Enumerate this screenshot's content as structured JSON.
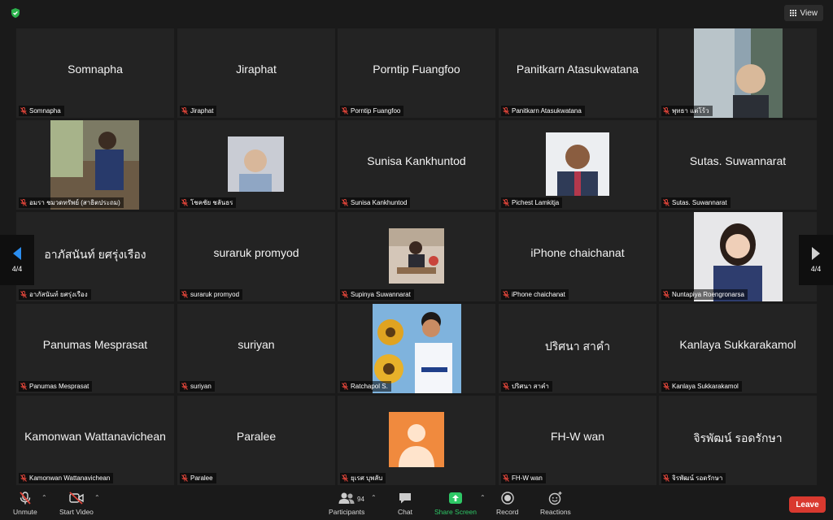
{
  "topbar": {
    "view_label": "View"
  },
  "pager": {
    "left_label": "4/4",
    "right_label": "4/4"
  },
  "tiles": [
    {
      "big": "Somnapha",
      "caption": "Somnapha"
    },
    {
      "big": "Jiraphat",
      "caption": "Jiraphat"
    },
    {
      "big": "Porntip Fuangfoo",
      "caption": "Porntip Fuangfoo"
    },
    {
      "big": "Panitkarn Atasukwatana",
      "caption": "Panitkarn Atasukwatana"
    },
    {
      "big": "",
      "caption": "พุทธา แต่โร้ว"
    },
    {
      "big": "",
      "caption": "อมรา ชมวดทรัพย์ (สาธิตประถม)"
    },
    {
      "big": "",
      "caption": "โชคชัย ชลันธร"
    },
    {
      "big": "Sunisa Kankhuntod",
      "caption": "Sunisa Kankhuntod"
    },
    {
      "big": "",
      "caption": "Pichest Lamkitja"
    },
    {
      "big": "Sutas. Suwannarat",
      "caption": "Sutas. Suwannarat"
    },
    {
      "big": "อาภัสนันท์ ยศรุ่งเรือง",
      "caption": "อาภัสนันท์ ยศรุ่งเรือง"
    },
    {
      "big": "suraruk promyod",
      "caption": "suraruk promyod"
    },
    {
      "big": "",
      "caption": "Supinya Suwannarat"
    },
    {
      "big": "iPhone chaichanat",
      "caption": "iPhone chaichanat"
    },
    {
      "big": "",
      "caption": "Nuntapiya Roengronarsa"
    },
    {
      "big": "Panumas Mesprasat",
      "caption": "Panumas Mesprasat"
    },
    {
      "big": "suriyan",
      "caption": "suriyan"
    },
    {
      "big": "",
      "caption": "Ratchapol S."
    },
    {
      "big": "ปริศนา สาคำ",
      "caption": "ปริศนา สาคำ"
    },
    {
      "big": "Kanlaya Sukkarakamol",
      "caption": "Kanlaya Sukkarakamol"
    },
    {
      "big": "Kamonwan Wattanavichean",
      "caption": "Kamonwan Wattanavichean"
    },
    {
      "big": "Paralee",
      "caption": "Paralee"
    },
    {
      "big": "",
      "caption": "ยุเรศ บุพลับ"
    },
    {
      "big": "FH-W wan",
      "caption": "FH-W wan"
    },
    {
      "big": "จิรพัฒน์ รอดรักษา",
      "caption": "จิรพัฒน์ รอดรักษา"
    }
  ],
  "toolbar": {
    "unmute": "Unmute",
    "start_video": "Start Video",
    "participants": "Participants",
    "participants_count": "94",
    "chat": "Chat",
    "share_screen": "Share Screen",
    "record": "Record",
    "reactions": "Reactions",
    "leave": "Leave"
  },
  "colors": {
    "share_green": "#2ec866",
    "leave_red": "#d9392f",
    "mic_red": "#e0453a"
  }
}
